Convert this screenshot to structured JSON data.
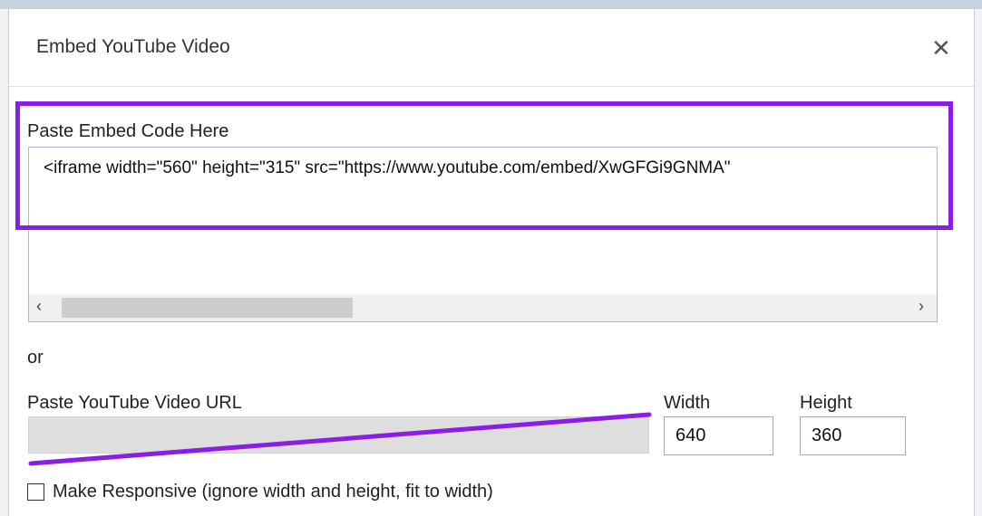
{
  "dialog": {
    "title": "Embed YouTube Video",
    "close_icon": "close-icon",
    "close_glyph": "✕"
  },
  "embed": {
    "label": "Paste Embed Code Here",
    "code": "<iframe width=\"560\" height=\"315\" src=\"https://www.youtube.com/embed/XwGFGi9GNMA\"",
    "scroll_left_glyph": "‹",
    "scroll_right_glyph": "›"
  },
  "or_text": "or",
  "url": {
    "label": "Paste YouTube Video URL",
    "value": ""
  },
  "size": {
    "width_label": "Width",
    "width_value": "640",
    "height_label": "Height",
    "height_value": "360"
  },
  "responsive": {
    "label": "Make Responsive (ignore width and height, fit to width)",
    "checked": false
  },
  "colors": {
    "highlight": "#8a1ee8",
    "url_field_bg": "#dedede"
  }
}
